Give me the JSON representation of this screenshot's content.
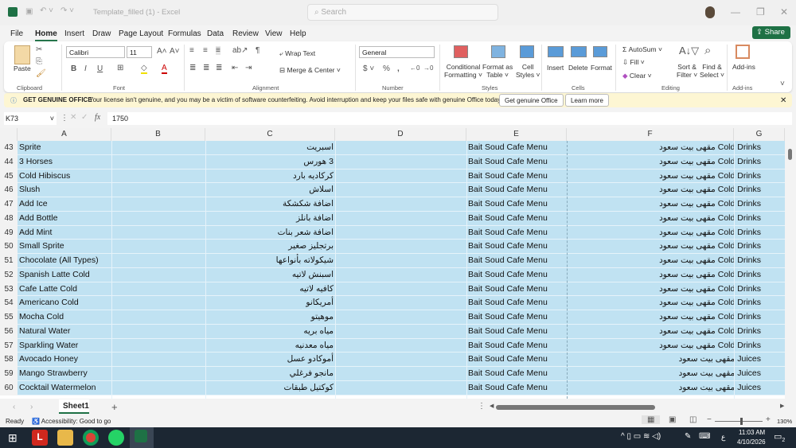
{
  "titlebar": {
    "title": "Template_filled (1)  -  Excel",
    "search_placeholder": "Search"
  },
  "menu": [
    "File",
    "Home",
    "Insert",
    "Draw",
    "Page Layout",
    "Formulas",
    "Data",
    "Review",
    "View",
    "Help"
  ],
  "share": "Share",
  "ribbon": {
    "paste": "Paste",
    "font": "Calibri",
    "size": "11",
    "wrap": "Wrap Text",
    "merge": "Merge & Center",
    "numfmt": "General",
    "cond": "Conditional",
    "cond2": "Formatting",
    "fmt_table": "Format as",
    "fmt_table2": "Table",
    "cell_styles": "Cell",
    "cell_styles2": "Styles",
    "insert": "Insert",
    "delete": "Delete",
    "format": "Format",
    "autosum": "AutoSum",
    "fill": "Fill",
    "clear": "Clear",
    "sort": "Sort &",
    "sort2": "Filter",
    "find": "Find &",
    "find2": "Select",
    "addins": "Add-ins",
    "groups": [
      "Clipboard",
      "Font",
      "Alignment",
      "Number",
      "Styles",
      "Cells",
      "Editing",
      "Add-ins"
    ]
  },
  "notice": {
    "title": "GET GENUINE OFFICE",
    "text": "Your license isn't genuine, and you may be a victim of software counterfeiting. Avoid interruption and keep your files safe with genuine Office today.",
    "btn1": "Get genuine Office",
    "btn2": "Learn more"
  },
  "formula": {
    "namebox": "K73",
    "value": "1750"
  },
  "columns": [
    "A",
    "B",
    "C",
    "D",
    "E",
    "F",
    "G"
  ],
  "rows": [
    [
      "43",
      "Sprite",
      "اسبريت",
      "Bait Soud Cafe Menu",
      "مقهى بيت سعود Cold Drinks"
    ],
    [
      "44",
      "3 Horses",
      "3 هورس",
      "Bait Soud Cafe Menu",
      "مقهى بيت سعود Cold Drinks"
    ],
    [
      "45",
      "Cold Hibiscus",
      "كركاديه بارد",
      "Bait Soud Cafe Menu",
      "مقهى بيت سعود Cold Drinks"
    ],
    [
      "46",
      "Slush",
      "اسلاش",
      "Bait Soud Cafe Menu",
      "مقهى بيت سعود Cold Drinks"
    ],
    [
      "47",
      "Add Ice",
      "اضافة شكشكة",
      "Bait Soud Cafe Menu",
      "مقهى بيت سعود Cold Drinks"
    ],
    [
      "48",
      "Add Bottle",
      "اضافة بانلز",
      "Bait Soud Cafe Menu",
      "مقهى بيت سعود Cold Drinks"
    ],
    [
      "49",
      "Add Mint",
      "اضافة شعر بنات",
      "Bait Soud Cafe Menu",
      "مقهى بيت سعود Cold Drinks"
    ],
    [
      "50",
      "Small Sprite",
      "برتجليز صغير",
      "Bait Soud Cafe Menu",
      "مقهى بيت سعود Cold Drinks"
    ],
    [
      "51",
      "Chocolate (All Types)",
      "شيكولاته بأنواعها",
      "Bait Soud Cafe Menu",
      "مقهى بيت سعود Cold Drinks"
    ],
    [
      "52",
      "Spanish Latte Cold",
      "اسبنش لاتيه",
      "Bait Soud Cafe Menu",
      "مقهى بيت سعود Cold Drinks"
    ],
    [
      "53",
      "Cafe Latte Cold",
      "كافيه لاتيه",
      "Bait Soud Cafe Menu",
      "مقهى بيت سعود Cold Drinks"
    ],
    [
      "54",
      "Americano Cold",
      "أمريكانو",
      "Bait Soud Cafe Menu",
      "مقهى بيت سعود Cold Drinks"
    ],
    [
      "55",
      "Mocha Cold",
      "موهيتو",
      "Bait Soud Cafe Menu",
      "مقهى بيت سعود Cold Drinks"
    ],
    [
      "56",
      "Natural Water",
      "مياه بريه",
      "Bait Soud Cafe Menu",
      "مقهى بيت سعود Cold Drinks"
    ],
    [
      "57",
      "Sparkling Water",
      "مياه معدنيه",
      "Bait Soud Cafe Menu",
      "مقهى بيت سعود Cold Drinks"
    ],
    [
      "58",
      "Avocado Honey",
      "أموكادو عسل",
      "Bait Soud Cafe Menu",
      "مقهى بيت سعود Juices"
    ],
    [
      "59",
      "Mango Strawberry",
      "مانجو فرغلي",
      "Bait Soud Cafe Menu",
      "مقهى بيت سعود Juices"
    ],
    [
      "60",
      "Cocktail Watermelon",
      "كوكتيل طبقات",
      "Bait Soud Cafe Menu",
      "مقهى بيت سعود Juices"
    ]
  ],
  "sheet_tab": "Sheet1",
  "status": {
    "ready": "Ready",
    "accessibility": "Accessibility: Good to go",
    "zoom": "130%"
  },
  "taskbar": {
    "time": "11:03 AM",
    "date": "4/10/2026",
    "notif": "2",
    "lang": "ع"
  }
}
